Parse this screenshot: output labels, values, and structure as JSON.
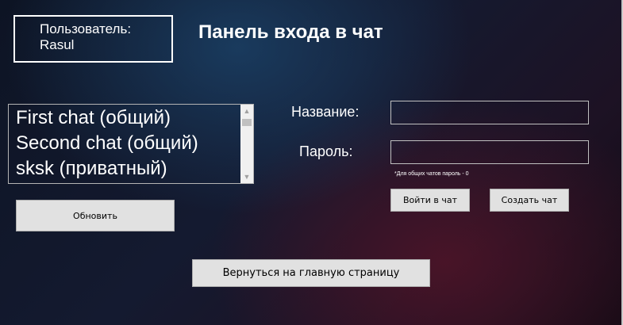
{
  "user": {
    "label": "Пользователь:",
    "name": "Rasul"
  },
  "title": "Панель входа в чат",
  "chats": [
    "First chat (общий)",
    "Second chat (общий)",
    "sksk (приватный)"
  ],
  "form": {
    "name_label": "Название:",
    "name_value": "",
    "password_label": "Пароль:",
    "password_value": "",
    "hint": "*Для общих чатов пароль - 0"
  },
  "buttons": {
    "refresh": "Обновить",
    "enter_chat": "Войти в чат",
    "create_chat": "Создать чат",
    "back_main": "Вернуться на главную страницу"
  },
  "icons": {
    "scroll_up": "chevron-up-icon",
    "scroll_down": "chevron-down-icon"
  },
  "colors": {
    "text": "#ffffff",
    "button_bg": "#e1e1e1",
    "border": "#c0c0c0"
  }
}
